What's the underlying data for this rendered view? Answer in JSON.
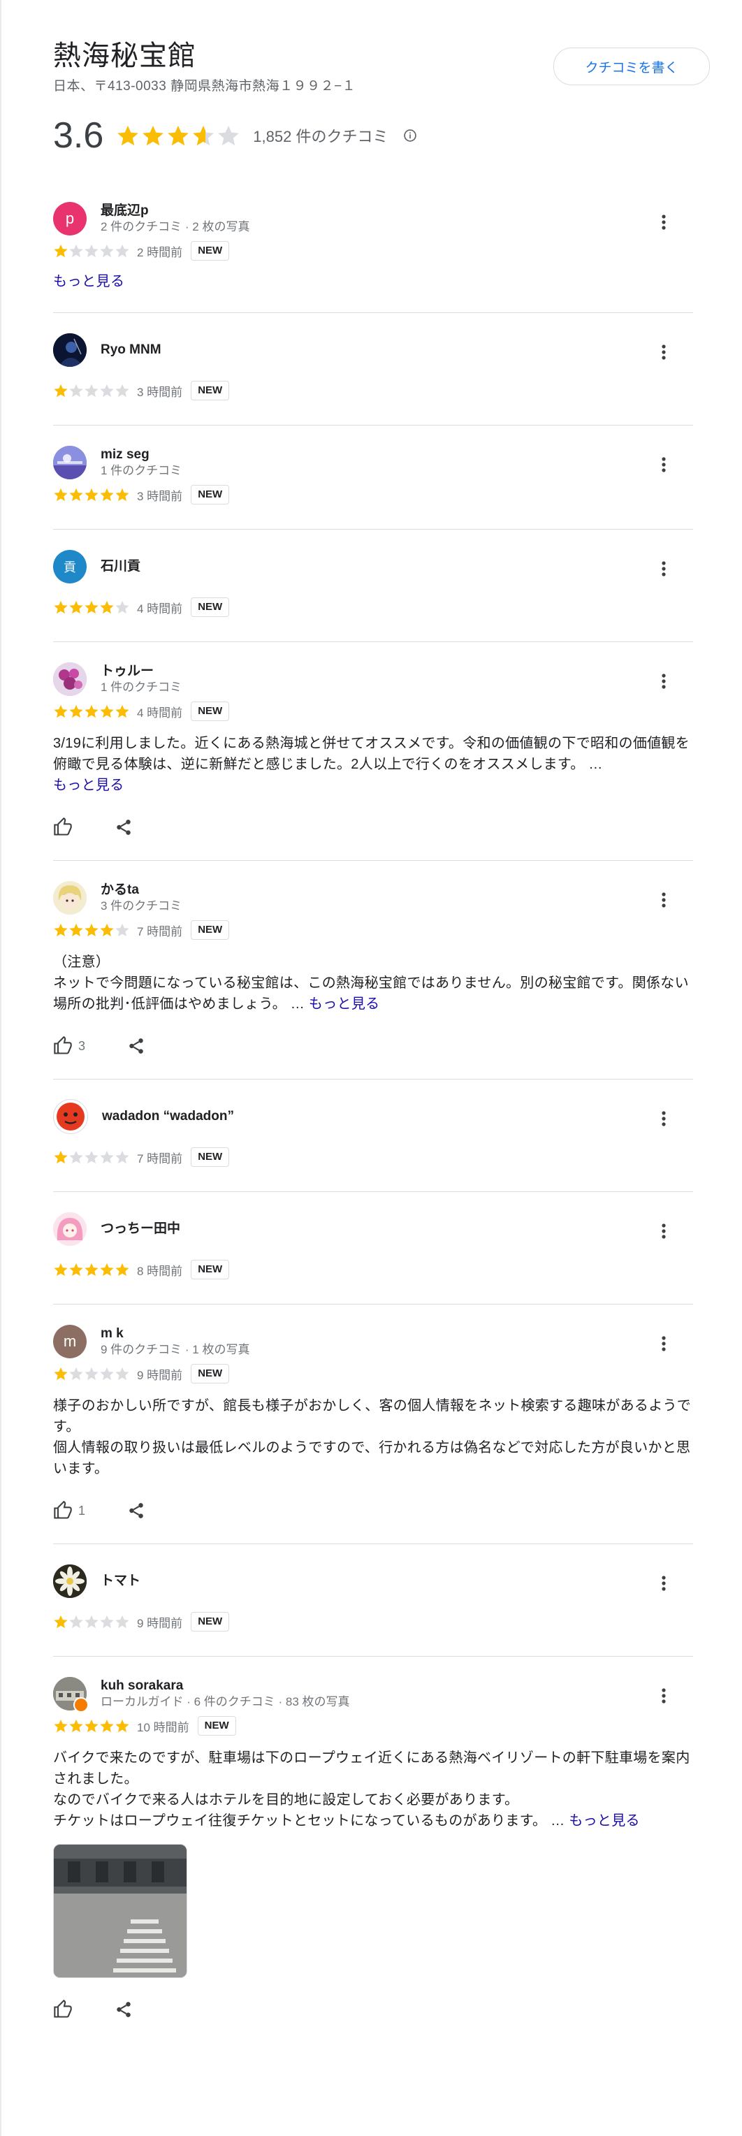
{
  "place": {
    "title": "熱海秘宝館",
    "address": "日本、〒413-0033 静岡県熱海市熱海１９９２−１",
    "write_review_label": "クチコミを書く",
    "rating": "3.6",
    "rating_value": 3.6,
    "review_count": "1,852 件のクチコミ"
  },
  "colors": {
    "star_on": "#fbbc04",
    "star_off": "#dadce0",
    "link": "#1a0dab",
    "accent": "#1a73e8"
  },
  "reviews": [
    {
      "name": "最底辺p",
      "meta": "2 件のクチコミ · 2 枚の写真",
      "stars": 1,
      "time": "2 時間前",
      "badge": "NEW",
      "more": "もっと見る",
      "avatar_letter": "p"
    },
    {
      "name": "Ryo MNM",
      "meta": "",
      "stars": 1,
      "time": "3 時間前",
      "badge": "NEW"
    },
    {
      "name": "miz seg",
      "meta": "1 件のクチコミ",
      "stars": 5,
      "time": "3 時間前",
      "badge": "NEW"
    },
    {
      "name": "石川貢",
      "meta": "",
      "stars": 4,
      "time": "4 時間前",
      "badge": "NEW",
      "avatar_letter": "貢"
    },
    {
      "name": "トゥルー",
      "meta": "1 件のクチコミ",
      "stars": 5,
      "time": "4 時間前",
      "badge": "NEW",
      "text": "3/19に利用しました。近くにある熱海城と併せてオススメです。令和の価値観の下で昭和の価値観を俯瞰で見る体験は、逆に新鮮だと感じました。2人以上で行くのをオススメします。 …",
      "more": "もっと見る"
    },
    {
      "name": "かるta",
      "meta": "3 件のクチコミ",
      "stars": 4,
      "time": "7 時間前",
      "badge": "NEW",
      "text_line1": "（注意）",
      "text": "ネットで今問題になっている秘宝館は、この熱海秘宝館ではありません。別の秘宝館です。関係ない場所の批判･低評価はやめましょう。 …",
      "more": "もっと見る",
      "likes": "3"
    },
    {
      "name": "wadadon “wadadon”",
      "meta": "",
      "stars": 1,
      "time": "7 時間前",
      "badge": "NEW"
    },
    {
      "name": "つっちー田中",
      "meta": "",
      "stars": 5,
      "time": "8 時間前",
      "badge": "NEW"
    },
    {
      "name": "m k",
      "meta": "9 件のクチコミ · 1 枚の写真",
      "stars": 1,
      "time": "9 時間前",
      "badge": "NEW",
      "avatar_letter": "m",
      "text_line1": "様子のおかしい所ですが、館長も様子がおかしく、客の個人情報をネット検索する趣味があるようです。",
      "text": "個人情報の取り扱いは最低レベルのようですので、行かれる方は偽名などで対応した方が良いかと思います。",
      "likes": "1"
    },
    {
      "name": "トマト",
      "meta": "",
      "stars": 1,
      "time": "9 時間前",
      "badge": "NEW"
    },
    {
      "name": "kuh sorakara",
      "meta": "ローカルガイド · 6 件のクチコミ · 83 枚の写真",
      "stars": 5,
      "time": "10 時間前",
      "badge": "NEW",
      "text_line1": "バイクで来たのですが、駐車場は下のロープウェイ近くにある熱海ベイリゾートの軒下駐車場を案内されました。",
      "text_line2": "なのでバイクで来る人はホテルを目的地に設定しておく必要があります。",
      "text": "チケットはロープウェイ往復チケットとセットになっているものがあります。 …",
      "more": "もっと見る"
    }
  ]
}
